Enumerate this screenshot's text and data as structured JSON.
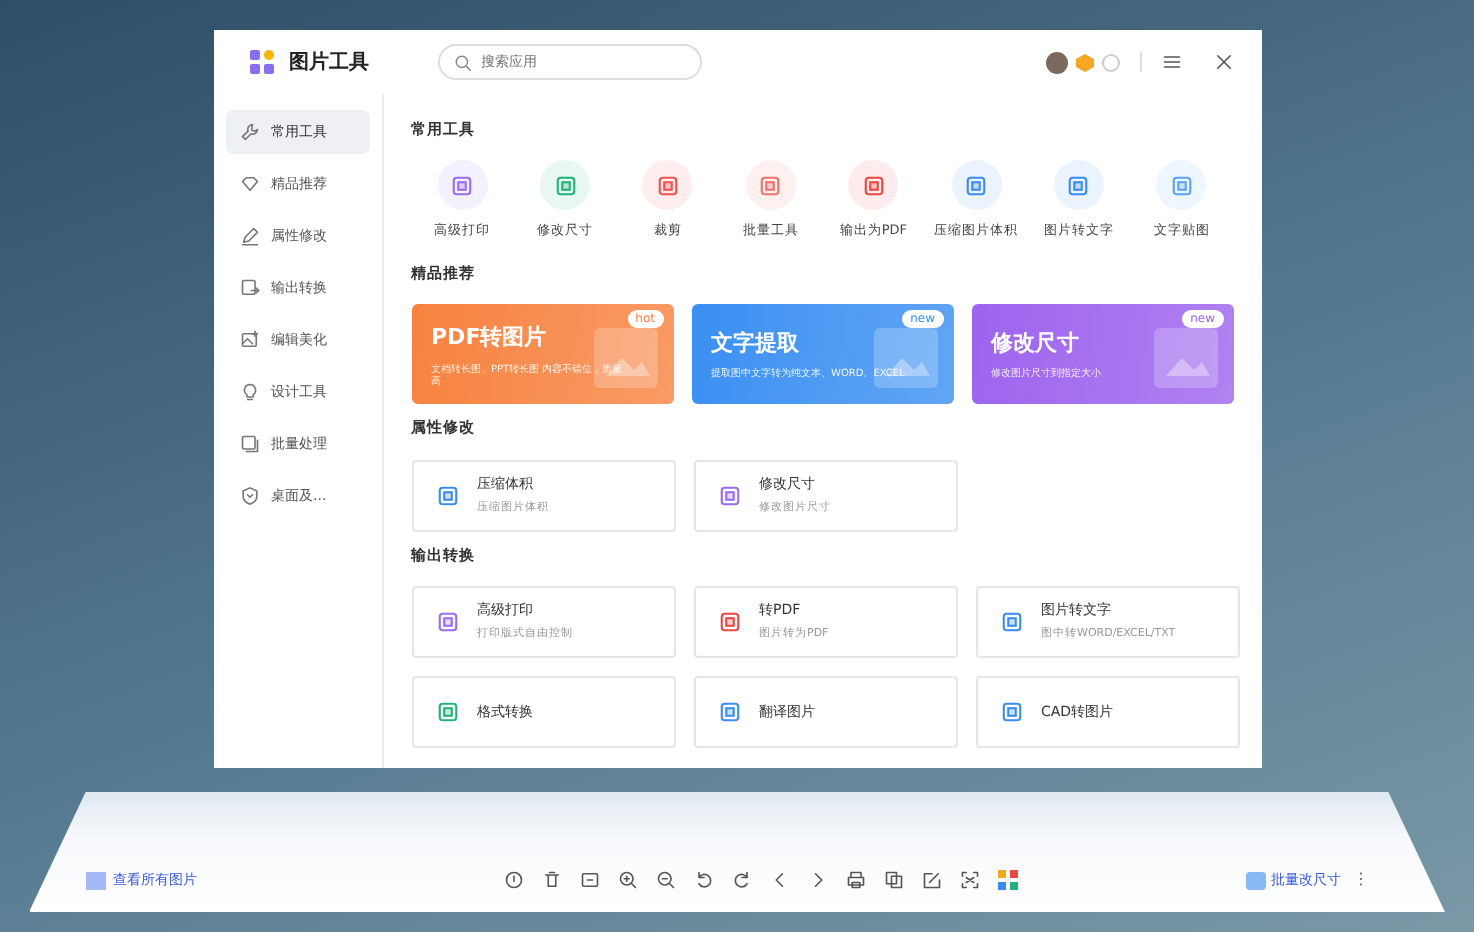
{
  "app": {
    "title": "图片工具"
  },
  "search": {
    "placeholder": "搜索应用"
  },
  "sidebar": {
    "items": [
      {
        "label": "常用工具",
        "selected": true
      },
      {
        "label": "精品推荐",
        "selected": false
      },
      {
        "label": "属性修改",
        "selected": false
      },
      {
        "label": "输出转换",
        "selected": false
      },
      {
        "label": "编辑美化",
        "selected": false
      },
      {
        "label": "设计工具",
        "selected": false
      },
      {
        "label": "批量处理",
        "selected": false
      },
      {
        "label": "桌面及...",
        "selected": false
      }
    ]
  },
  "sections": [
    {
      "title": "常用工具",
      "kind": "tools",
      "items": [
        {
          "label": "高级打印",
          "color": "#9b6cf0"
        },
        {
          "label": "修改尺寸",
          "color": "#1fb37a"
        },
        {
          "label": "裁剪",
          "color": "#f0514f"
        },
        {
          "label": "批量工具",
          "color": "#f0716a"
        },
        {
          "label": "输出为PDF",
          "color": "#e8483f"
        },
        {
          "label": "压缩图片体积",
          "color": "#3b8cf0"
        },
        {
          "label": "图片转文字",
          "color": "#3b8cf0"
        },
        {
          "label": "文字贴图",
          "color": "#5aa2f5"
        }
      ]
    },
    {
      "title": "精品推荐",
      "kind": "banners",
      "items": [
        {
          "title": "PDF转图片",
          "subtitle": "文档转长图、PPT转长图 内容不错位，质量高",
          "badge": "hot",
          "color": "#f7823f"
        },
        {
          "title": "文字提取",
          "subtitle": "提取图中文字转为纯文本、WORD、EXCEL",
          "badge": "new",
          "color": "#3a8ff2"
        },
        {
          "title": "修改尺寸",
          "subtitle": "修改图片尺寸到指定大小",
          "badge": "new",
          "color": "#9d63ee"
        }
      ]
    },
    {
      "title": "属性修改",
      "kind": "cards",
      "items": [
        {
          "title": "压缩体积",
          "subtitle": "压缩图片体积",
          "color": "#3b8cf0"
        },
        {
          "title": "修改尺寸",
          "subtitle": "修改图片尺寸",
          "color": "#9b6cf0"
        }
      ]
    },
    {
      "title": "输出转换",
      "kind": "cards",
      "items": [
        {
          "title": "高级打印",
          "subtitle": "打印版式自由控制",
          "color": "#9b6cf0"
        },
        {
          "title": "转PDF",
          "subtitle": "图片转为PDF",
          "color": "#e8483f"
        },
        {
          "title": "图片转文字",
          "subtitle": "图中转WORD/EXCEL/TXT",
          "color": "#3b8cf0"
        },
        {
          "title": "格式转换",
          "color": "#1fb37a"
        },
        {
          "title": "翻译图片",
          "color": "#3b8cf0"
        },
        {
          "title": "CAD转图片",
          "color": "#3b8cf0"
        }
      ]
    }
  ],
  "bottom_bar": {
    "view_all": "查看所有图片",
    "batch_button": "批量改尺寸",
    "more": "⋮"
  }
}
